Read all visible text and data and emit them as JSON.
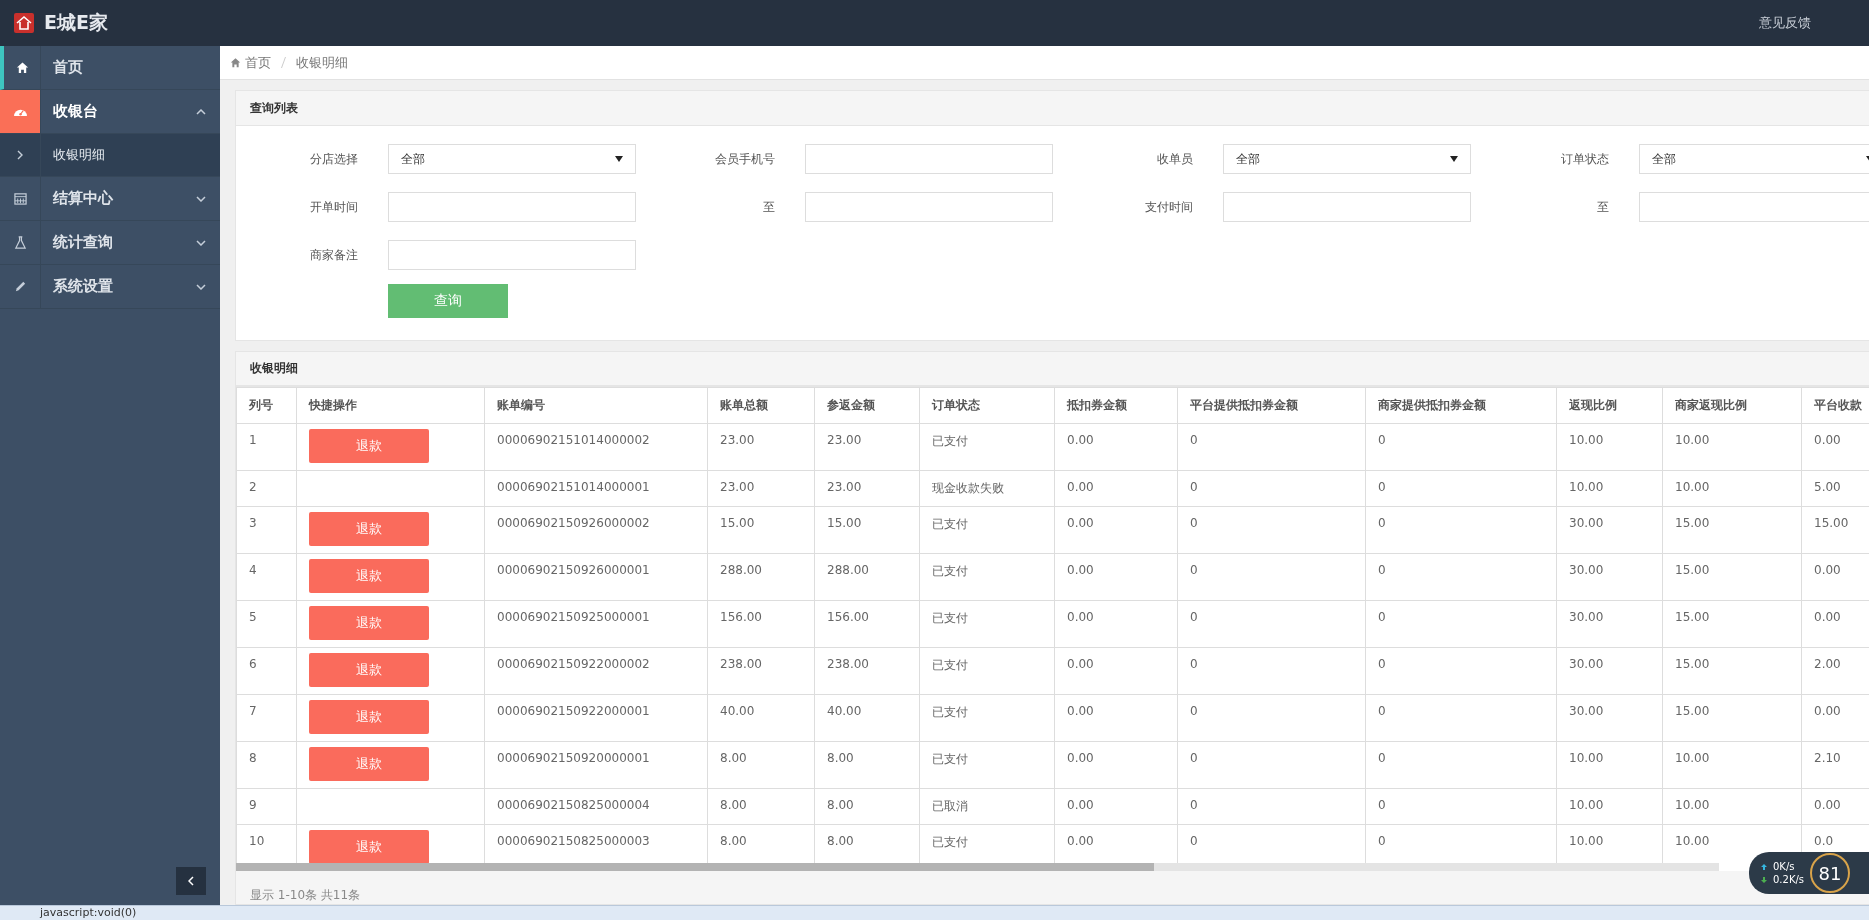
{
  "header": {
    "brand": "E城E家",
    "links": [
      "意见反馈"
    ]
  },
  "sidebar": {
    "items": [
      {
        "label": "首页",
        "selected": false
      },
      {
        "label": "收银台",
        "selected": true,
        "expanded": true,
        "children": [
          {
            "label": "收银明细",
            "selected": true
          }
        ]
      },
      {
        "label": "结算中心",
        "selected": false,
        "expanded": false
      },
      {
        "label": "统计查询",
        "selected": false,
        "expanded": false
      },
      {
        "label": "系统设置",
        "selected": false,
        "expanded": false
      }
    ]
  },
  "breadcrumb": [
    "首页",
    "收银明细"
  ],
  "query_panel": {
    "title": "查询列表",
    "fields": [
      {
        "label": "分店选择",
        "kind": "select",
        "value": "全部"
      },
      {
        "label": "会员手机号",
        "kind": "text"
      },
      {
        "label": "收单员",
        "kind": "select",
        "value": "全部"
      },
      {
        "label": "订单状态",
        "kind": "select",
        "value": "全部"
      },
      {
        "label": "开单时间",
        "kind": "text"
      },
      {
        "label": "至",
        "kind": "text"
      },
      {
        "label": "支付时间",
        "kind": "text"
      },
      {
        "label": "至",
        "kind": "text"
      },
      {
        "label": "商家备注",
        "kind": "text"
      }
    ],
    "button": "查询"
  },
  "table": {
    "title": "收银明细",
    "columns": [
      "列号",
      "快捷操作",
      "账单编号",
      "账单总额",
      "参返金额",
      "订单状态",
      "抵扣券金额",
      "平台提供抵扣券金额",
      "商家提供抵扣券金额",
      "返现比例",
      "商家返现比例",
      "平台收款"
    ],
    "rows": [
      {
        "cells": [
          "1",
          "退款",
          "00006902151014000002",
          "23.00",
          "23.00",
          "已支付",
          "0.00",
          "0",
          "0",
          "10.00",
          "10.00",
          "0.00"
        ]
      },
      {
        "cells": [
          "2",
          "",
          "00006902151014000001",
          "23.00",
          "23.00",
          "现金收款失败",
          "0.00",
          "0",
          "0",
          "10.00",
          "10.00",
          "5.00"
        ]
      },
      {
        "cells": [
          "3",
          "退款",
          "00006902150926000002",
          "15.00",
          "15.00",
          "已支付",
          "0.00",
          "0",
          "0",
          "30.00",
          "15.00",
          "15.00"
        ]
      },
      {
        "cells": [
          "4",
          "退款",
          "00006902150926000001",
          "288.00",
          "288.00",
          "已支付",
          "0.00",
          "0",
          "0",
          "30.00",
          "15.00",
          "0.00"
        ]
      },
      {
        "cells": [
          "5",
          "退款",
          "00006902150925000001",
          "156.00",
          "156.00",
          "已支付",
          "0.00",
          "0",
          "0",
          "30.00",
          "15.00",
          "0.00"
        ]
      },
      {
        "cells": [
          "6",
          "退款",
          "00006902150922000002",
          "238.00",
          "238.00",
          "已支付",
          "0.00",
          "0",
          "0",
          "30.00",
          "15.00",
          "2.00"
        ]
      },
      {
        "cells": [
          "7",
          "退款",
          "00006902150922000001",
          "40.00",
          "40.00",
          "已支付",
          "0.00",
          "0",
          "0",
          "30.00",
          "15.00",
          "0.00"
        ]
      },
      {
        "cells": [
          "8",
          "退款",
          "00006902150920000001",
          "8.00",
          "8.00",
          "已支付",
          "0.00",
          "0",
          "0",
          "10.00",
          "10.00",
          "2.10"
        ]
      },
      {
        "cells": [
          "9",
          "",
          "00006902150825000004",
          "8.00",
          "8.00",
          "已取消",
          "0.00",
          "0",
          "0",
          "10.00",
          "10.00",
          "0.00"
        ]
      },
      {
        "cells": [
          "10",
          "退款",
          "00006902150825000003",
          "8.00",
          "8.00",
          "已支付",
          "0.00",
          "0",
          "0",
          "10.00",
          "10.00",
          "0.0"
        ]
      }
    ],
    "footer": "显示 1-10条 共11条"
  },
  "net_monitor": {
    "upload": "0K/s",
    "download": "0.2K/s",
    "reading": "81"
  },
  "status_bar": "javascript:void(0)"
}
